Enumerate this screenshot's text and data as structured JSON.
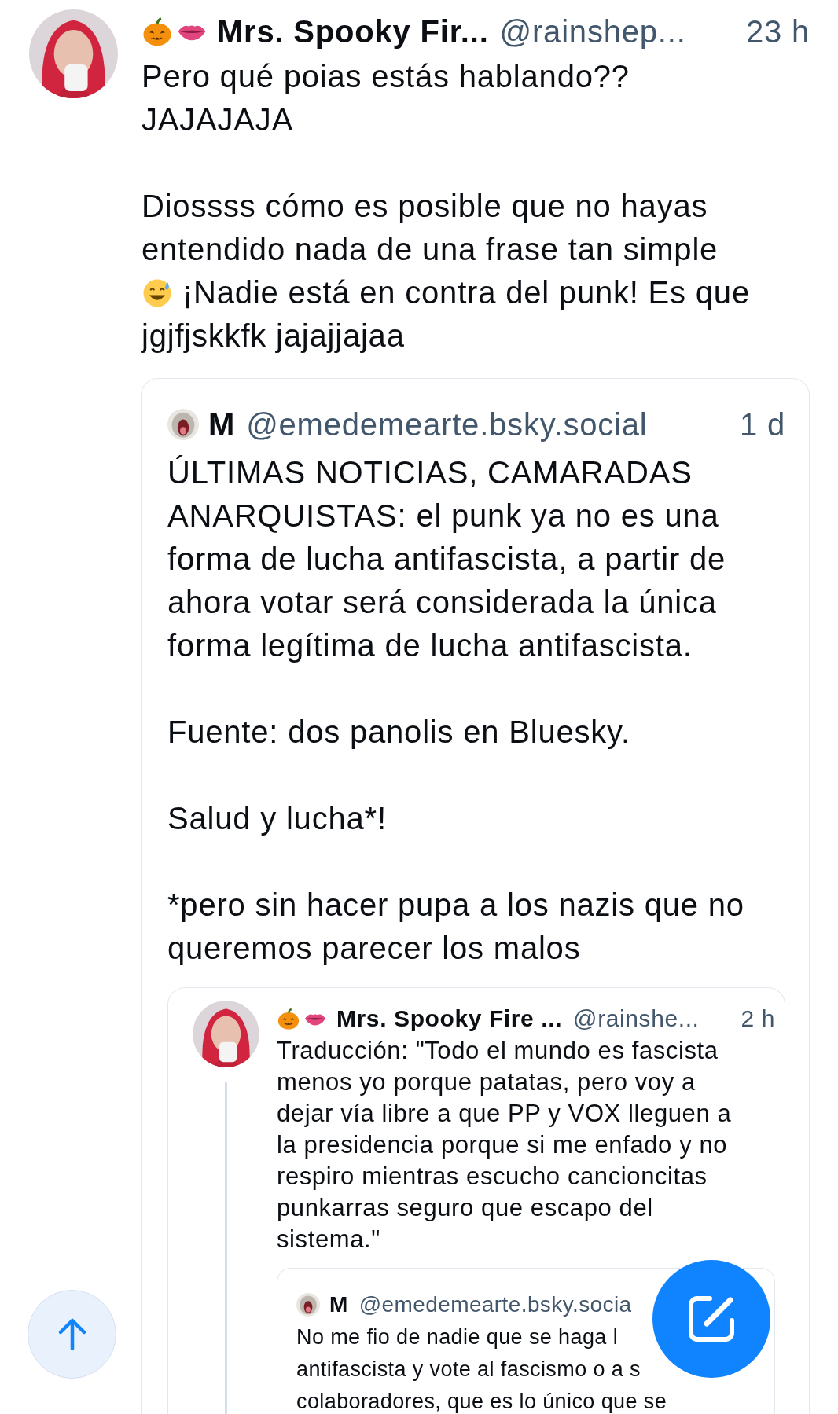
{
  "post": {
    "author": {
      "name_icons": true,
      "display_name": "Mrs. Spooky Fir...",
      "handle": "@rainshep...",
      "time": "23 h"
    },
    "paragraphs": [
      {
        "text": "Pero qué poias estás hablando??\nJAJAJAJA"
      },
      {
        "kind": "with-icon",
        "text": "Diossss cómo es posible que no hayas entendido nada de una frase tan simple",
        "icon_line": "¡Nadie está en contra del punk! Es que",
        "after": "jgjfjskkfk jajajjajaa"
      }
    ],
    "quote": {
      "author": {
        "display_name": "M",
        "handle": "@emedemearte.bsky.social",
        "time": "1 d"
      },
      "paragraphs": [
        {
          "text": "ÚLTIMAS NOTICIAS, CAMARADAS ANARQUISTAS: el punk ya no es una forma de lucha antifascista, a partir de ahora votar será considerada la única forma legítima de lucha antifascista."
        },
        {
          "text": "Fuente: dos panolis en Bluesky."
        },
        {
          "text": "Salud y lucha*!"
        },
        {
          "text": "*pero sin hacer pupa a los nazis que no queremos parecer los malos"
        }
      ],
      "quote": {
        "author": {
          "name_icons": true,
          "display_name": "Mrs. Spooky Fire ...",
          "handle": "@rainshe...",
          "time": "2 h"
        },
        "paragraphs": [
          {
            "text": "Traducción: \"Todo el mundo es fascista menos yo porque patatas, pero voy a dejar vía libre a que PP y VOX lleguen a la presidencia porque si me enfado y no respiro mientras escucho cancioncitas punkarras seguro que escapo del sistema.\""
          }
        ],
        "quote": {
          "author": {
            "display_name": "M",
            "handle": "@emedemearte.bsky.socia"
          },
          "lines": [
            "No me fio de nadie que se haga l",
            "antifascista y vote al fascismo o a s",
            "colaboradores, que es lo único que se"
          ]
        }
      }
    }
  }
}
